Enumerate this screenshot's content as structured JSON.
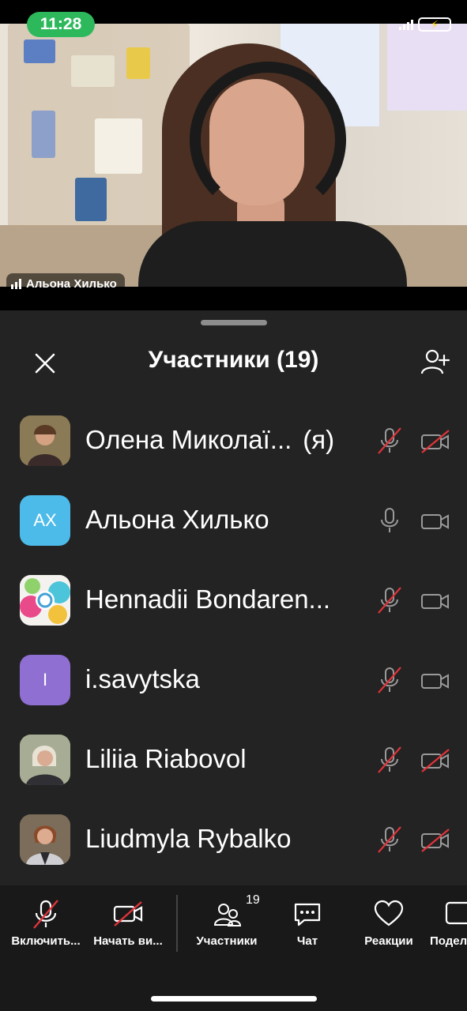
{
  "status_bar": {
    "time": "11:28"
  },
  "video": {
    "speaker_name": "Альона Хилько"
  },
  "panel": {
    "title": "Участники (19)",
    "me_suffix": "(я)",
    "participants": [
      {
        "name": "Олена Миколаї...",
        "avatar_text": "",
        "mic_muted": true,
        "cam_off": true
      },
      {
        "name": "Альона Хилько",
        "avatar_text": "АХ",
        "avatar_color": "#4dbbe9",
        "mic_muted": false,
        "cam_off": false
      },
      {
        "name": "Hennadii Bondaren...",
        "avatar_text": "",
        "mic_muted": true,
        "cam_off": false
      },
      {
        "name": "i.savytska",
        "avatar_text": "I",
        "avatar_color": "#8f6fd1",
        "mic_muted": true,
        "cam_off": false
      },
      {
        "name": "Liliia Riabovol",
        "avatar_text": "",
        "mic_muted": true,
        "cam_off": true
      },
      {
        "name": "Liudmyla Rybalko",
        "avatar_text": "",
        "mic_muted": true,
        "cam_off": true
      }
    ]
  },
  "toolbar": {
    "unmute_label": "Включить...",
    "start_video_label": "Начать ви...",
    "participants_label": "Участники",
    "participants_count": "19",
    "chat_label": "Чат",
    "reactions_label": "Реакции",
    "share_label": "Подел"
  },
  "colors": {
    "muted_slash": "#e0333a",
    "sheet_bg": "#232323",
    "toolbar_bg": "#191919"
  }
}
